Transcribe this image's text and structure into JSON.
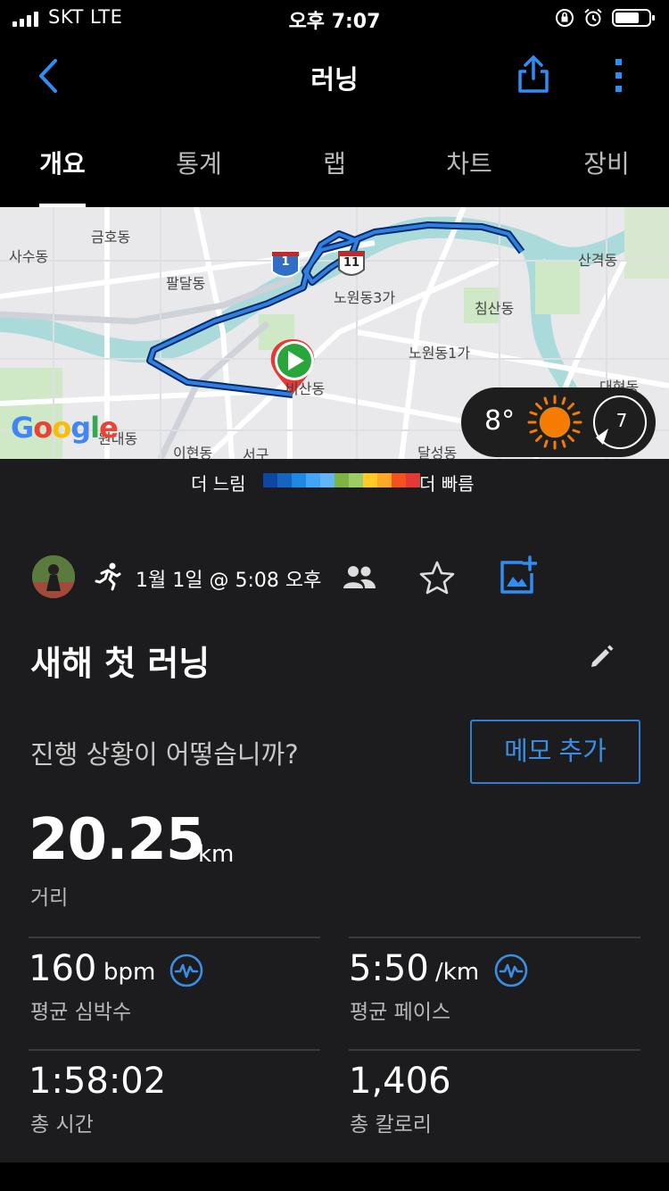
{
  "status_bar": {
    "carrier": "SKT   LTE",
    "time": "오후 7:07",
    "icons": [
      "signal-icon",
      "orientation-lock-icon",
      "alarm-icon",
      "battery-icon"
    ]
  },
  "nav": {
    "title": "러닝",
    "back_icon": "chevron-left-icon",
    "share_icon": "share-icon",
    "more_icon": "more-vertical-icon"
  },
  "tabs": [
    {
      "label": "개요",
      "active": true
    },
    {
      "label": "통계",
      "active": false
    },
    {
      "label": "랩",
      "active": false
    },
    {
      "label": "차트",
      "active": false
    },
    {
      "label": "장비",
      "active": false
    }
  ],
  "map": {
    "labels": [
      "금호동",
      "사수동",
      "팔달동",
      "노원동3가",
      "산격동",
      "침산동",
      "노원동1가",
      "대현동",
      "비산동",
      "이현동",
      "서구",
      "달성동",
      "원대동"
    ],
    "road_shields": [
      "1",
      "11"
    ],
    "attribution": "Google",
    "route_color": "#1a73e8"
  },
  "weather": {
    "temperature": "8°",
    "wind_speed": "7",
    "icon": "sunny-icon",
    "wind_icon": "wind-direction-icon"
  },
  "legend": {
    "slow": "더 느림",
    "fast": "더 빠름",
    "colors": [
      "#0d47a1",
      "#1565c0",
      "#1e88e5",
      "#42a5f5",
      "#64b5f6",
      "#7cb342",
      "#9ccc65",
      "#ffca28",
      "#ffa726",
      "#f4511e",
      "#e53935"
    ]
  },
  "activity": {
    "date": "1월 1일 @ 5:08 오후",
    "title": "새해 첫 러닝",
    "prompt": "진행 상황이 어떻습니까?",
    "memo_button": "메모 추가",
    "accent_color": "#3b8ee5"
  },
  "stats": {
    "distance": {
      "value": "20.25",
      "unit": "km",
      "label": "거리"
    },
    "avg_hr": {
      "value": "160",
      "unit": "bpm",
      "label": "평균 심박수"
    },
    "avg_pace": {
      "value": "5:50",
      "unit": "/km",
      "label": "평균 페이스"
    },
    "total_time": {
      "value": "1:58:02",
      "label": "총 시간"
    },
    "calories": {
      "value": "1,406",
      "label": "총 칼로리"
    }
  }
}
